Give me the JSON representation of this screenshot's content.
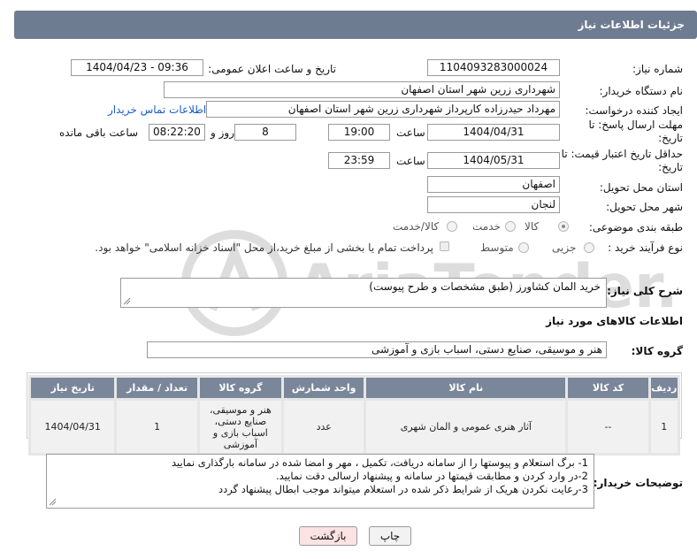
{
  "header": {
    "title": "جزئیات اطلاعات نیاز"
  },
  "fields": {
    "need_number_label": "شماره نیاز:",
    "need_number": "1104093283000024",
    "announce_label": "تاریخ و ساعت اعلان عمومی:",
    "announce_value": "1404/04/23 - 09:36",
    "buyer_org_label": "نام دستگاه خریدار:",
    "buyer_org": "شهرداری زرین شهر استان اصفهان",
    "creator_label": "ایجاد کننده درخواست:",
    "creator": "مهرداد حیدرزاده کارپرداز شهرداری زرین شهر استان اصفهان",
    "contact_link": "اطلاعات تماس خریدار",
    "reply_deadline_label": "مهلت ارسال پاسخ: تا تاریخ:",
    "reply_date": "1404/04/31",
    "time_label": "ساعت",
    "reply_time": "19:00",
    "days_value": "8",
    "days_label": "روز و",
    "remaining_time": "08:22:20",
    "remaining_label": "ساعت باقی مانده",
    "price_validity_label": "حداقل تاریخ اعتبار قیمت: تا تاریخ:",
    "price_date": "1404/05/31",
    "price_time_label": "ساعت",
    "price_time": "23:59",
    "province_label": "استان محل تحویل:",
    "province": "اصفهان",
    "city_label": "شهر محل تحویل:",
    "city": "لنجان",
    "category_label": "طبقه بندی موضوعی:",
    "category_options": [
      "کالا",
      "خدمت",
      "کالا/خدمت"
    ],
    "process_label": "نوع فرآیند خرید :",
    "process_options": [
      "جزیی",
      "متوسط"
    ],
    "payment_note": "پرداخت تمام یا بخشی از مبلغ خرید،از محل \"اسناد خزانه اسلامی\" خواهد بود."
  },
  "description": {
    "label": "شرح کلی نیاز:",
    "value": "خرید المان کشاورز (طبق مشخصات و طرح پیوست)"
  },
  "goods_section": {
    "title": "اطلاعات کالاهای مورد نیاز",
    "group_label": "گروه کالا:",
    "group_value": "هنر و موسیقی، صنایع دستی، اسباب بازی و آموزشی"
  },
  "table": {
    "headers": [
      "ردیف",
      "کد کالا",
      "نام کالا",
      "واحد شمارش",
      "گروه کالا",
      "تعداد / مقدار",
      "تاریخ نیاز"
    ],
    "rows": [
      [
        "1",
        "--",
        "آثار هنری عمومی و المان شهری",
        "عدد",
        "هنر و موسیقی، صنایع دستی، اسباب بازی و آموزشی",
        "1",
        "1404/04/31"
      ]
    ]
  },
  "buyer_notes": {
    "label": "توضیحات خریدار:",
    "lines": [
      "1- برگ استعلام و پیوستها را از سامانه دریافت، تکمیل ، مهر و امضا شده در سامانه بارگذاری نمایید",
      "2-در وارد کردن و مطابقت قیمتها در سامانه و پیشنهاد ارسالی دقت نمایید.",
      "3-رعایت نکردن هریک از شرایط  ذکر شده در استعلام میتواند موجب ابطال پیشنهاد گردد"
    ]
  },
  "buttons": {
    "print": "چاپ",
    "back": "بازگشت"
  },
  "watermark_text": "AriaTender.net",
  "colors": {
    "header_bg": "#6e7c91",
    "table_header_bg": "#7a8699",
    "link": "#1a5cc8",
    "back_btn_bg": "#fbe3e3"
  }
}
